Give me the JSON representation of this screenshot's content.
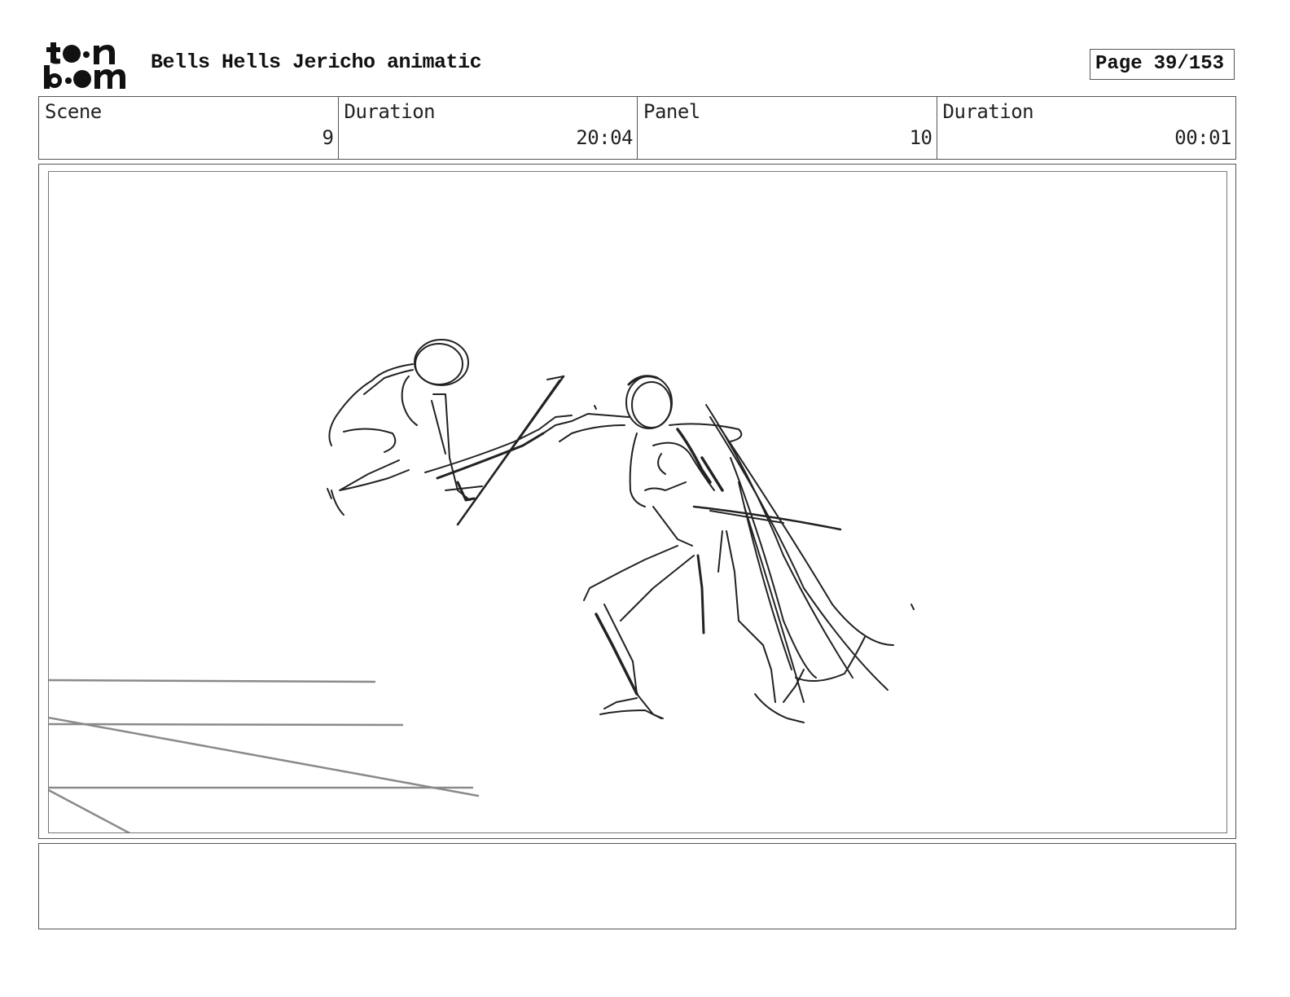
{
  "header": {
    "logo_text": "toonboom",
    "project_title": "Bells Hells Jericho animatic",
    "page_label": "Page",
    "page_number": "39/153"
  },
  "info": {
    "scene_label": "Scene",
    "scene_value": "9",
    "scene_duration_label": "Duration",
    "scene_duration_value": "20:04",
    "panel_label": "Panel",
    "panel_value": "10",
    "panel_duration_label": "Duration",
    "panel_duration_value": "00:01"
  },
  "notes": {
    "text": ""
  },
  "colors": {
    "border": "#555555",
    "sketch": "#222222",
    "ground_lines": "#888888"
  }
}
